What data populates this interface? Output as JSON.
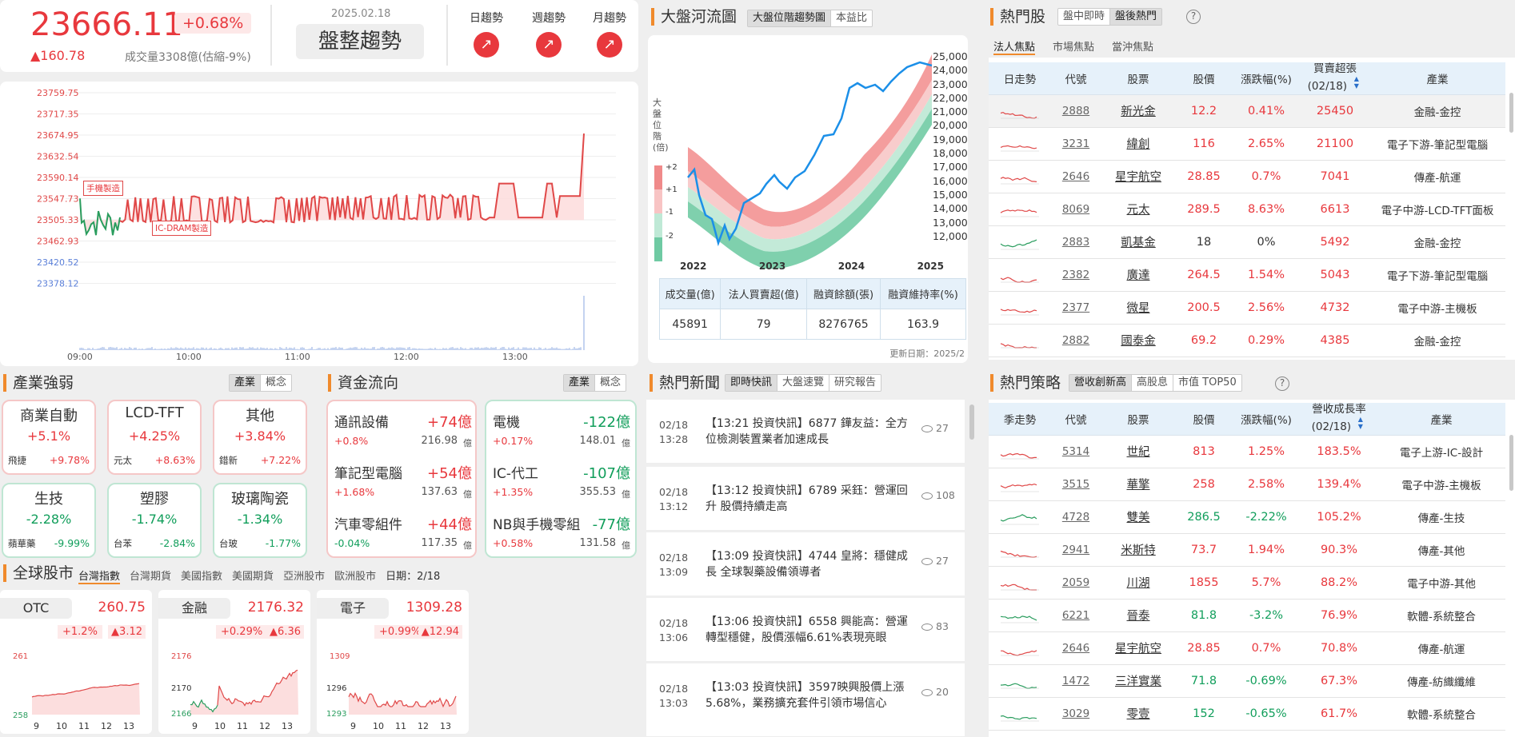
{
  "index": {
    "value": "23666.11",
    "pct": "+0.68%",
    "change": "▲160.78",
    "volume": "成交量3308億(估縮-9%)",
    "date": "2025.02.18",
    "trend": "盤整趨勢",
    "trends": [
      "日趨勢",
      "週趨勢",
      "月趨勢"
    ]
  },
  "intraday": {
    "yticks": [
      "23759.75",
      "23717.35",
      "23674.95",
      "23632.54",
      "23590.14",
      "23547.73",
      "23505.33",
      "23462.93",
      "23420.52",
      "23378.12"
    ],
    "xticks": [
      "09:00",
      "10:00",
      "11:00",
      "12:00",
      "13:00"
    ],
    "ann1": "手機製造",
    "ann2": "IC-DRAM製造"
  },
  "river": {
    "title": "大盤河流圖",
    "tabs": [
      "大盤位階趨勢圖",
      "本益比"
    ],
    "ylabel": "大盤位階(倍)",
    "bands": [
      "+2",
      "+1",
      "-1",
      "-2"
    ],
    "yticks": [
      "25,000",
      "24,000",
      "23,000",
      "22,000",
      "21,000",
      "20,000",
      "19,000",
      "18,000",
      "17,000",
      "16,000",
      "15,000",
      "14,000",
      "13,000",
      "12,000"
    ],
    "xticks": [
      "2022",
      "2023",
      "2024",
      "2025"
    ],
    "stat_heads": [
      "成交量(億)",
      "法人買賣超(億)",
      "融資餘額(張)",
      "融資維持率(%)"
    ],
    "stat_vals": [
      "45891",
      "79",
      "8276765",
      "163.9"
    ],
    "updated": "更新日期：2025/2"
  },
  "hot": {
    "title": "熱門股",
    "tabs": [
      "盤中即時",
      "盤後熱門"
    ],
    "help": "?",
    "subtabs": [
      "法人焦點",
      "市場焦點",
      "當沖焦點"
    ],
    "heads": [
      "日走勢",
      "代號",
      "股票",
      "股價",
      "漲跌幅(%)",
      "買賣超張\n(02/18)",
      "產業"
    ],
    "sort": "▲▼",
    "rows": [
      [
        "2888",
        "新光金",
        "12.2",
        "0.41%",
        "25450",
        "金融-金控",
        "r"
      ],
      [
        "3231",
        "緯創",
        "116",
        "2.65%",
        "21100",
        "電子下游-筆記型電腦",
        "r"
      ],
      [
        "2646",
        "星宇航空",
        "28.85",
        "0.7%",
        "7041",
        "傳產-航運",
        "r"
      ],
      [
        "8069",
        "元太",
        "289.5",
        "8.63%",
        "6613",
        "電子中游-LCD-TFT面板",
        "r"
      ],
      [
        "2883",
        "凱基金",
        "18",
        "0%",
        "5492",
        "金融-金控",
        "n"
      ],
      [
        "2382",
        "廣達",
        "264.5",
        "1.54%",
        "5043",
        "電子下游-筆記型電腦",
        "r"
      ],
      [
        "2377",
        "微星",
        "200.5",
        "2.56%",
        "4732",
        "電子中游-主機板",
        "r"
      ],
      [
        "2882",
        "國泰金",
        "69.2",
        "0.29%",
        "4385",
        "金融-金控",
        "r"
      ]
    ]
  },
  "strategy": {
    "title": "熱門策略",
    "tabs": [
      "營收創新高",
      "高股息",
      "市值 TOP50"
    ],
    "help": "?",
    "heads": [
      "季走勢",
      "代號",
      "股票",
      "股價",
      "漲跌幅(%)",
      "營收成長率\n(02/18)",
      "產業"
    ],
    "sort": "▲▼",
    "rows": [
      [
        "5314",
        "世紀",
        "813",
        "1.25%",
        "183.5%",
        "電子上游-IC-設計",
        "r"
      ],
      [
        "3515",
        "華擎",
        "258",
        "2.58%",
        "139.4%",
        "電子中游-主機板",
        "r"
      ],
      [
        "4728",
        "雙美",
        "286.5",
        "-2.22%",
        "105.2%",
        "傳產-生技",
        "g"
      ],
      [
        "2941",
        "米斯特",
        "73.7",
        "1.94%",
        "90.3%",
        "傳產-其他",
        "r"
      ],
      [
        "2059",
        "川湖",
        "1855",
        "5.7%",
        "88.2%",
        "電子中游-其他",
        "r"
      ],
      [
        "6221",
        "晉泰",
        "81.8",
        "-3.2%",
        "76.9%",
        "軟體-系統整合",
        "g"
      ],
      [
        "2646",
        "星宇航空",
        "28.85",
        "0.7%",
        "70.8%",
        "傳產-航運",
        "r"
      ],
      [
        "1472",
        "三洋實業",
        "71.8",
        "-0.69%",
        "67.3%",
        "傳產-紡織纖維",
        "g"
      ],
      [
        "3029",
        "零壹",
        "152",
        "-0.65%",
        "61.7%",
        "軟體-系統整合",
        "g"
      ]
    ]
  },
  "industry": {
    "title": "產業強弱",
    "tabs": [
      "產業",
      "概念"
    ],
    "items": [
      {
        "name": "商業自動",
        "pct": "+5.1%",
        "stock": "飛捷",
        "spct": "+9.78%",
        "c": "r"
      },
      {
        "name": "LCD-TFT",
        "pct": "+4.25%",
        "stock": "元太",
        "spct": "+8.63%",
        "c": "r"
      },
      {
        "name": "其他",
        "pct": "+3.84%",
        "stock": "錯新",
        "spct": "+7.22%",
        "c": "r"
      },
      {
        "name": "生技",
        "pct": "-2.28%",
        "stock": "蘋華藥",
        "spct": "-9.99%",
        "c": "g"
      },
      {
        "name": "塑膠",
        "pct": "-1.74%",
        "stock": "台苯",
        "spct": "-2.84%",
        "c": "g"
      },
      {
        "name": "玻璃陶瓷",
        "pct": "-1.34%",
        "stock": "台玻",
        "spct": "-1.77%",
        "c": "g"
      }
    ]
  },
  "flow": {
    "title": "資金流向",
    "tabs": [
      "產業",
      "概念"
    ],
    "in": [
      {
        "name": "通訊設備",
        "amt": "+74億",
        "pct": "+0.8%",
        "total": "216.98",
        "unit": "億"
      },
      {
        "name": "筆記型電腦",
        "amt": "+54億",
        "pct": "+1.68%",
        "total": "137.63",
        "unit": "億"
      },
      {
        "name": "汽車零組件",
        "amt": "+44億",
        "pct": "-0.04%",
        "total": "117.35",
        "unit": "億"
      }
    ],
    "out": [
      {
        "name": "電機",
        "amt": "-122億",
        "pct": "+0.17%",
        "total": "148.01",
        "unit": "億"
      },
      {
        "name": "IC-代工",
        "amt": "-107億",
        "pct": "+1.35%",
        "total": "355.53",
        "unit": "億"
      },
      {
        "name": "NB與手機零組",
        "amt": "-77億",
        "pct": "+0.58%",
        "total": "131.58",
        "unit": "億"
      }
    ]
  },
  "global": {
    "title": "全球股市",
    "tabs": [
      "台灣指數",
      "台灣期貨",
      "美國指數",
      "美國期貨",
      "亞洲股市",
      "歐洲股市"
    ],
    "date": "日期：2/18",
    "cards": [
      {
        "name": "OTC",
        "value": "260.75",
        "pct": "+1.2%",
        "chg": "▲3.12",
        "yt": [
          "261",
          "258"
        ],
        "xt": [
          "9",
          "10",
          "11",
          "12",
          "13"
        ]
      },
      {
        "name": "金融",
        "value": "2176.32",
        "pct": "+0.29%",
        "chg": "▲6.36",
        "yt": [
          "2176",
          "2170",
          "2166"
        ],
        "xt": [
          "9",
          "10",
          "11",
          "12",
          "13"
        ]
      },
      {
        "name": "電子",
        "value": "1309.28",
        "pct": "+0.99%",
        "chg": "▲12.94",
        "yt": [
          "1309",
          "1296",
          "1293"
        ],
        "xt": [
          "9",
          "10",
          "11",
          "12",
          "13"
        ]
      }
    ]
  },
  "news": {
    "title": "熱門新聞",
    "tabs": [
      "即時快訊",
      "大盤速覽",
      "研究報告"
    ],
    "items": [
      {
        "d": "02/18",
        "t": "13:28",
        "text": "【13:21 投資快訊】6877 鏵友益：全方位檢測裝置業者加速成長",
        "views": "27"
      },
      {
        "d": "02/18",
        "t": "13:12",
        "text": "【13:12 投資快訊】6789 采鈺：營運回升 股價持續走高",
        "views": "108"
      },
      {
        "d": "02/18",
        "t": "13:09",
        "text": "【13:09 投資快訊】4744 皇將：穩健成長 全球製藥設備領導者",
        "views": "27"
      },
      {
        "d": "02/18",
        "t": "13:06",
        "text": "【13:06 投資快訊】6558 興能高：營運轉型穩健，股價漲幅6.61%表現亮眼",
        "views": "83"
      },
      {
        "d": "02/18",
        "t": "13:03",
        "text": "【13:03 投資快訊】3597映興股價上漲5.68%，業務擴充套件引領市場信心",
        "views": "20"
      }
    ]
  }
}
